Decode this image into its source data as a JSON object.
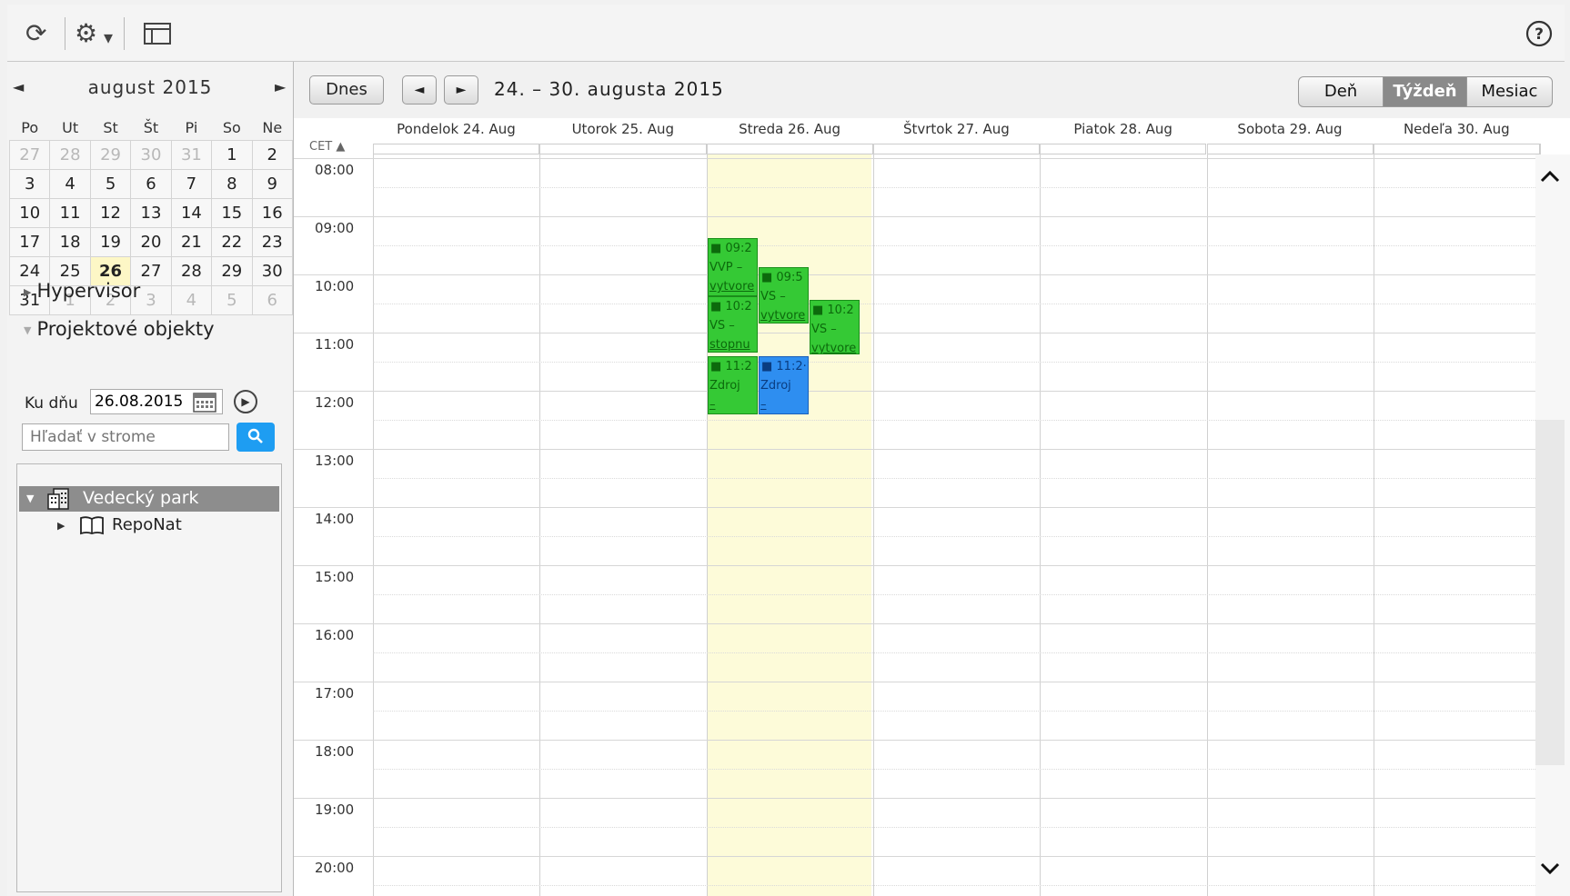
{
  "toolbar": {
    "icons": [
      "refresh-icon",
      "gear-icon",
      "dropdown-icon",
      "layout-icon",
      "help-icon"
    ],
    "refresh_glyph": "⟳",
    "gear_glyph": "⚙",
    "caret_glyph": "▾",
    "help_glyph": "?"
  },
  "mini_calendar": {
    "title": "august 2015",
    "prev": "◄",
    "next": "►",
    "weekdays": [
      "Po",
      "Ut",
      "St",
      "Št",
      "Pi",
      "So",
      "Ne"
    ],
    "weeks": [
      [
        "27",
        "28",
        "29",
        "30",
        "31",
        "1",
        "2"
      ],
      [
        "3",
        "4",
        "5",
        "6",
        "7",
        "8",
        "9"
      ],
      [
        "10",
        "11",
        "12",
        "13",
        "14",
        "15",
        "16"
      ],
      [
        "17",
        "18",
        "19",
        "20",
        "21",
        "22",
        "23"
      ],
      [
        "24",
        "25",
        "26",
        "27",
        "28",
        "29",
        "30"
      ],
      [
        "31",
        "1",
        "2",
        "3",
        "4",
        "5",
        "6"
      ]
    ],
    "today": "26"
  },
  "tree_sections": {
    "hypervisor": "Hypervisor",
    "projects": "Projektové objekty"
  },
  "filters": {
    "date_label": "Ku dňu",
    "date_value": "26.08.2015",
    "search_placeholder": "Hľadať v strome"
  },
  "tree": {
    "root": "Vedecký park",
    "child": "RepoNat"
  },
  "calendar": {
    "today_button": "Dnes",
    "prev": "◄",
    "next": "►",
    "range": "24. – 30. augusta 2015",
    "views": [
      "Deň",
      "Týždeň",
      "Mesiac"
    ],
    "active_view": "Týždeň",
    "timezone": "CET ▲",
    "days": [
      "Pondelok 24. Aug",
      "Utorok 25. Aug",
      "Streda 26. Aug",
      "Štvrtok 27. Aug",
      "Piatok 28. Aug",
      "Sobota 29. Aug",
      "Nedeľa 30. Aug"
    ],
    "hours": [
      "08:00",
      "09:00",
      "10:00",
      "11:00",
      "12:00",
      "13:00",
      "14:00",
      "15:00",
      "16:00",
      "17:00",
      "18:00",
      "19:00",
      "20:00"
    ],
    "events": [
      {
        "time": "■ 09:2",
        "title": "VVP –",
        "extra": "vytvore",
        "color": "green"
      },
      {
        "time": "■ 09:5",
        "title": "VS –",
        "extra": "vytvore",
        "color": "green"
      },
      {
        "time": "■ 10:2",
        "title": "VS –",
        "extra": "stopnu",
        "color": "green"
      },
      {
        "time": "■ 10:2",
        "title": "VS –",
        "extra": "vytvore",
        "color": "green"
      },
      {
        "time": "■ 11:2",
        "title": "Zdroj",
        "extra": "–",
        "color": "green"
      },
      {
        "time": "■ 11:2·",
        "title": "Zdroj",
        "extra": "–",
        "color": "blue"
      }
    ]
  },
  "colors": {
    "event_green": "#35c935",
    "event_blue": "#2e8ef0",
    "today_highlight": "#fdfbd9",
    "search_button": "#1e9df2"
  }
}
